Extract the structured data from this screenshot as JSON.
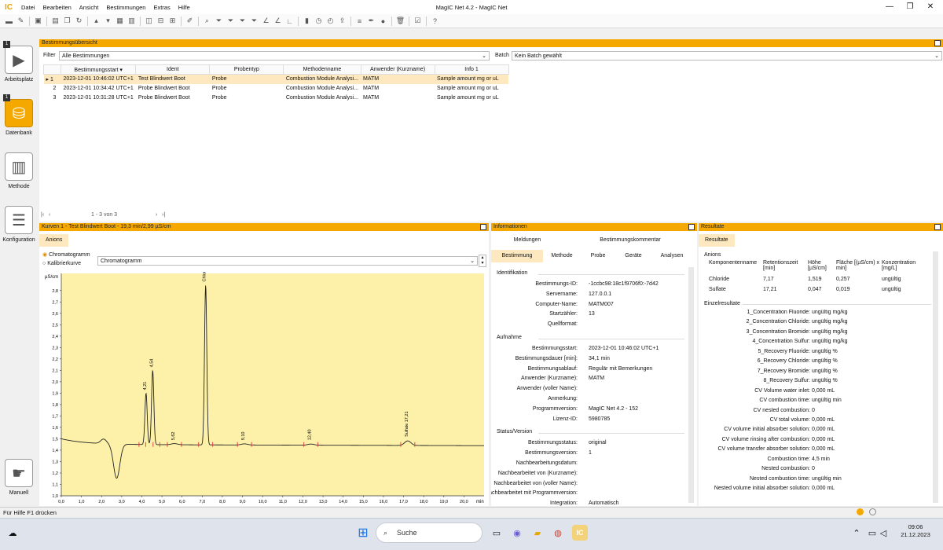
{
  "window": {
    "title": "MagIC Net 4.2 - MagIC Net",
    "logo": "IC"
  },
  "menu": [
    "Datei",
    "Bearbeiten",
    "Ansicht",
    "Bestimmungen",
    "Extras",
    "Hilfe"
  ],
  "sidebar": {
    "items": [
      {
        "label": "Arbeitsplatz",
        "badge": "1",
        "icon": "workplace-icon"
      },
      {
        "label": "Datenbank",
        "badge": "1",
        "icon": "database-icon"
      },
      {
        "label": "Methode",
        "icon": "method-icon"
      },
      {
        "label": "Konfiguration",
        "icon": "configuration-icon"
      },
      {
        "label": "Manuell",
        "icon": "manual-icon"
      }
    ]
  },
  "overview": {
    "title": "Bestimmungsübersicht",
    "filter_label": "Filter",
    "filter_value": "Alle Bestimmungen",
    "batch_label": "Batch",
    "batch_value": "Kein Batch gewählt",
    "columns": [
      "Bestimmungsstart",
      "Ident",
      "Probentyp",
      "Methodenname",
      "Anwender (Kurzname)",
      "Info 1"
    ],
    "rows": [
      {
        "n": "1",
        "start": "2023-12-01 10:46:02 UTC+1",
        "ident": "Test Blindwert Boot",
        "typ": "Probe",
        "method": "Combustion Module Analysi...",
        "user": "MATM",
        "info": "Sample amount mg or uL"
      },
      {
        "n": "2",
        "start": "2023-12-01 10:34:42 UTC+1",
        "ident": "Probe Blindwert Boot",
        "typ": "Probe",
        "method": "Combustion Module Analysi...",
        "user": "MATM",
        "info": "Sample amount mg or uL"
      },
      {
        "n": "3",
        "start": "2023-12-01 10:31:28 UTC+1",
        "ident": "Probe Blindwert Boot",
        "typ": "Probe",
        "method": "Combustion Module Analysi...",
        "user": "MATM",
        "info": "Sample amount mg or uL"
      }
    ],
    "pager": "1 - 3 von 3"
  },
  "curves": {
    "title": "Kurven 1 - Test Blindwert Boot - 19,3 min/2,99 µS/cm",
    "tab": "Anions",
    "radio_chromatogram": "Chromatogramm",
    "radio_calibration": "Kalibrierkurve",
    "select_value": "Chromatogramm"
  },
  "chart_data": {
    "type": "line",
    "ylabel": "µS/cm",
    "xlabel": "min",
    "xlim": [
      0,
      21
    ],
    "ylim": [
      1.0,
      2.95
    ],
    "x_ticks": [
      "0,0",
      "1,0",
      "2,0",
      "3,0",
      "4,0",
      "5,0",
      "6,0",
      "7,0",
      "8,0",
      "9,0",
      "10,0",
      "11,0",
      "12,0",
      "13,0",
      "14,0",
      "15,0",
      "16,0",
      "17,0",
      "18,0",
      "19,0",
      "20,0"
    ],
    "y_ticks": [
      "1,0",
      "1,1",
      "1,2",
      "1,3",
      "1,4",
      "1,5",
      "1,6",
      "1,7",
      "1,8",
      "1,9",
      "2,0",
      "2,1",
      "2,2",
      "2,3",
      "2,4",
      "2,5",
      "2,6",
      "2,7",
      "2,8"
    ],
    "baseline": 1.45,
    "dip": {
      "x": 2.75,
      "y": 1.15
    },
    "peaks": [
      {
        "x": 4.21,
        "y": 1.9,
        "label": "4,21"
      },
      {
        "x": 4.54,
        "y": 2.1,
        "label": "4,54"
      },
      {
        "x": 5.62,
        "y": 1.46,
        "label": "5,62"
      },
      {
        "x": 7.17,
        "y": 2.85,
        "label": "Chloride 7,17"
      },
      {
        "x": 9.1,
        "y": 1.46,
        "label": "9,10"
      },
      {
        "x": 12.4,
        "y": 1.46,
        "label": "12,40"
      },
      {
        "x": 17.21,
        "y": 1.49,
        "label": "Sulfate 17,21"
      }
    ]
  },
  "info": {
    "title": "Informationen",
    "tabs_top": [
      "Meldungen",
      "Bestimmungskommentar"
    ],
    "tabs": [
      "Bestimmung",
      "Methode",
      "Probe",
      "Geräte",
      "Analysen"
    ],
    "sections": [
      {
        "title": "Identifikation",
        "rows": [
          {
            "k": "Bestimmungs-ID:",
            "v": "-1ccbc98:18c1f9706f0:-7d42"
          },
          {
            "k": "Servername:",
            "v": "127.0.0.1"
          },
          {
            "k": "Computer-Name:",
            "v": "MATM007"
          },
          {
            "k": "Startzähler:",
            "v": "13"
          },
          {
            "k": "Quellformat:",
            "v": ""
          }
        ]
      },
      {
        "title": "Aufnahme",
        "rows": [
          {
            "k": "Bestimmungsstart:",
            "v": "2023-12-01 10:46:02 UTC+1"
          },
          {
            "k": "Bestimmungsdauer [min]:",
            "v": "34,1 min"
          },
          {
            "k": "Bestimmungsablauf:",
            "v": "Regulär mit Bemerkungen"
          },
          {
            "k": "Anwender (Kurzname):",
            "v": "MATM"
          },
          {
            "k": "Anwender (voller Name):",
            "v": ""
          },
          {
            "k": "Anmerkung:",
            "v": ""
          },
          {
            "k": "Programmversion:",
            "v": "MagIC Net 4.2 - 152"
          },
          {
            "k": "Lizenz-ID:",
            "v": "5980785"
          }
        ]
      },
      {
        "title": "Status/Version",
        "rows": [
          {
            "k": "Bestimmungsstatus:",
            "v": "original"
          },
          {
            "k": "Bestimmungsversion:",
            "v": "1"
          },
          {
            "k": "Nachbearbeitungsdatum:",
            "v": ""
          },
          {
            "k": "Nachbearbeitet von (Kurzname):",
            "v": ""
          },
          {
            "k": "Nachbearbeitet von (voller Name):",
            "v": ""
          },
          {
            "k": "Nachbearbeitet mit Programmversion:",
            "v": ""
          },
          {
            "k": "Integration:",
            "v": "Automatisch"
          }
        ]
      }
    ]
  },
  "results": {
    "title": "Resultate",
    "tab": "Resultate",
    "section_anions": "Anions",
    "columns": [
      "Komponentenname",
      "Retentionszeit [min]",
      "Höhe [µS/cm]",
      "Fläche [(µS/cm) x min]",
      "Konzentration [mg/L]"
    ],
    "rows": [
      {
        "name": "Chloride",
        "rt": "7,17",
        "h": "1,519",
        "a": "0,257",
        "c": "ungültig"
      },
      {
        "name": "Sulfate",
        "rt": "17,21",
        "h": "0,047",
        "a": "0,019",
        "c": "ungültig"
      }
    ],
    "section_single": "Einzelresultate",
    "single": [
      {
        "k": "1_Concentration Fluoride:",
        "v": "ungültig mg/kg"
      },
      {
        "k": "2_Concentration Chloride:",
        "v": "ungültig mg/kg"
      },
      {
        "k": "3_Concentration Bromide:",
        "v": "ungültig mg/kg"
      },
      {
        "k": "4_Concentration Sulfur:",
        "v": "ungültig mg/kg"
      },
      {
        "k": "5_Recovery Fluoride:",
        "v": "ungültig %"
      },
      {
        "k": "6_Recovery Chloride:",
        "v": "ungültig %"
      },
      {
        "k": "7_Recovery Bromide:",
        "v": "ungültig %"
      },
      {
        "k": "8_Recovery Sulfur:",
        "v": "ungültig %"
      },
      {
        "k": "CV Volume water inlet:",
        "v": "0,000 mL"
      },
      {
        "k": "CV combustion time:",
        "v": "ungültig min"
      },
      {
        "k": "CV nested combustion:",
        "v": "0"
      },
      {
        "k": "CV total volume:",
        "v": "0,000 mL"
      },
      {
        "k": "CV volume initial absorber solution:",
        "v": "0,000 mL"
      },
      {
        "k": "CV volume rinsing after combustion:",
        "v": "0,000 mL"
      },
      {
        "k": "CV volume transfer absorber solution:",
        "v": "0,000 mL"
      },
      {
        "k": "Combustion time:",
        "v": "4,5 min"
      },
      {
        "k": "Nested combustion:",
        "v": "0"
      },
      {
        "k": "Nested combustion time:",
        "v": "ungültig min"
      },
      {
        "k": "Nested volume  initial absorber solution:",
        "v": "0,000 mL"
      }
    ]
  },
  "statusbar": {
    "text": "Für Hilfe F1 drücken"
  },
  "taskbar": {
    "search_placeholder": "Suche",
    "time": "09:06",
    "date": "21.12.2023"
  }
}
